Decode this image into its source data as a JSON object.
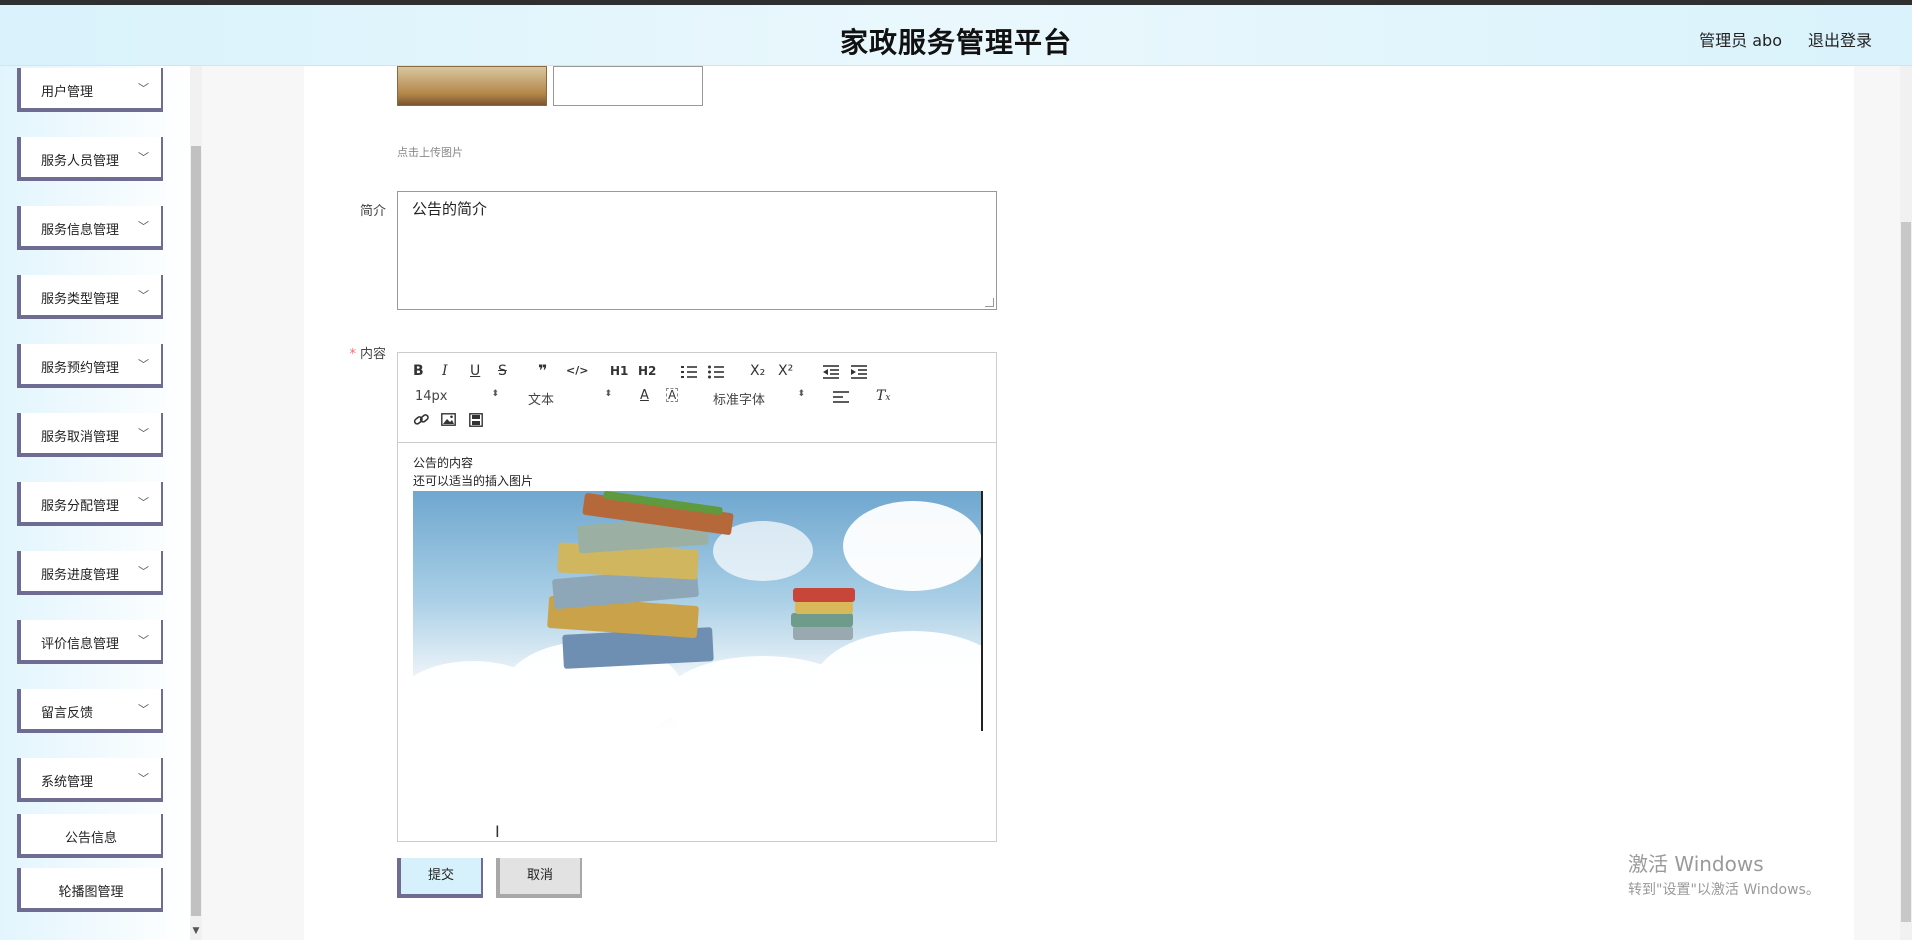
{
  "header": {
    "title": "家政服务管理平台",
    "user": "管理员 abo",
    "logout": "退出登录"
  },
  "sidebar": {
    "items": [
      {
        "label": "用户管理"
      },
      {
        "label": "服务人员管理"
      },
      {
        "label": "服务信息管理"
      },
      {
        "label": "服务类型管理"
      },
      {
        "label": "服务预约管理"
      },
      {
        "label": "服务取消管理"
      },
      {
        "label": "服务分配管理"
      },
      {
        "label": "服务进度管理"
      },
      {
        "label": "评价信息管理"
      },
      {
        "label": "留言反馈"
      },
      {
        "label": "系统管理"
      }
    ],
    "sub_items": [
      {
        "label": "公告信息"
      },
      {
        "label": "轮播图管理"
      }
    ]
  },
  "form": {
    "upload_hint": "点击上传图片",
    "intro_label": "简介",
    "intro_value": "公告的简介",
    "content_label": "内容",
    "content_required_mark": "*",
    "content_lines": [
      "公告的内容",
      "还可以适当的插入图片"
    ],
    "submit_label": "提交",
    "cancel_label": "取消"
  },
  "editor_toolbar": {
    "row1": [
      "B",
      "I",
      "U",
      "S",
      "❞",
      "</>",
      "H1",
      "H2",
      "ordered-list",
      "bullet-list",
      "X₂",
      "X²",
      "outdent",
      "indent"
    ],
    "font_size": "14px",
    "block_format": "文本",
    "font_family": "标准字体"
  },
  "watermark": {
    "line1": "激活 Windows",
    "line2": "转到\"设置\"以激活 Windows。"
  }
}
